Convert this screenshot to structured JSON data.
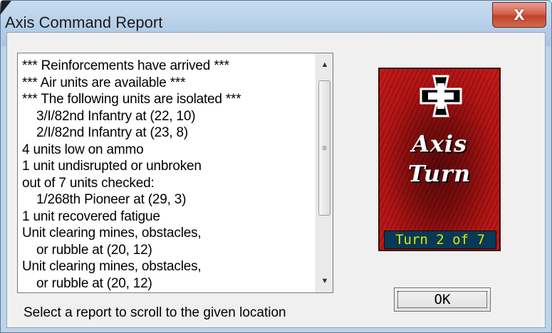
{
  "window": {
    "title": "Axis Command Report",
    "close_label": "X"
  },
  "report_list": {
    "items": [
      {
        "text": "*** Reinforcements have arrived ***",
        "indent": false
      },
      {
        "text": "*** Air units are available ***",
        "indent": false
      },
      {
        "text": "*** The following units are isolated ***",
        "indent": false
      },
      {
        "text": "3/I/82nd Infantry at (22, 10)",
        "indent": true
      },
      {
        "text": "2/I/82nd Infantry at (23, 8)",
        "indent": true
      },
      {
        "text": "4 units low on ammo",
        "indent": false
      },
      {
        "text": "1 unit undisrupted or unbroken",
        "indent": false
      },
      {
        "text": "out of 7 units checked:",
        "indent": false
      },
      {
        "text": "1/268th Pioneer at (29, 3)",
        "indent": true
      },
      {
        "text": "1 unit recovered fatigue",
        "indent": false
      },
      {
        "text": "Unit clearing mines, obstacles,",
        "indent": false
      },
      {
        "text": "or rubble at (20, 12)",
        "indent": true
      },
      {
        "text": "Unit clearing mines, obstacles,",
        "indent": false
      },
      {
        "text": "or rubble at (20, 12)",
        "indent": true
      }
    ]
  },
  "status_text": "Select a report to scroll to the given location",
  "turn_panel": {
    "line1": "Axis",
    "line2": "Turn",
    "counter": "Turn  2  of  7",
    "colors": {
      "panel": "#c81a1a",
      "counter_bg": "#063a56",
      "counter_text": "#e7e000"
    }
  },
  "ok_label": "OK",
  "icons": {
    "close": "close-icon",
    "scroll_up": "scroll-up-icon",
    "scroll_down": "scroll-down-icon",
    "cross": "iron-cross-icon"
  }
}
